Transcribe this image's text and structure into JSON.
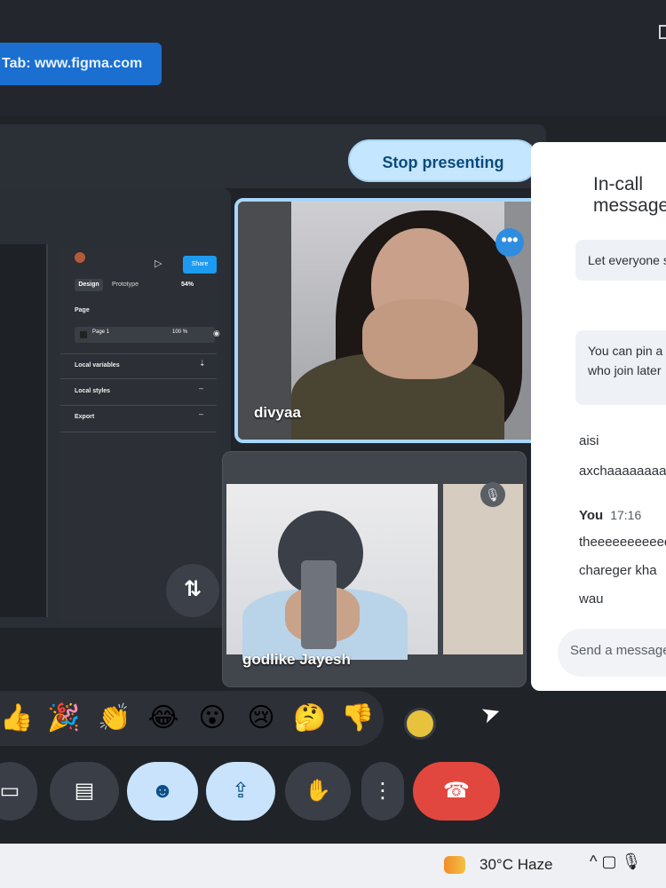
{
  "browser": {
    "tab_banner": "Tab: www.figma.com"
  },
  "meet": {
    "stop_presenting_label": "Stop presenting",
    "swap_icon": "swap-vertical-icon",
    "participants": [
      {
        "name": "divyaa",
        "active_speaker": true
      },
      {
        "name": "godlike Jayesh",
        "muted": true
      }
    ]
  },
  "figma_panel": {
    "share_label": "Share",
    "tab_design": "Design",
    "tab_prototype": "Prototype",
    "zoom": "54%",
    "page_section": "Page",
    "page_name": "Page 1",
    "page_value": "100",
    "page_unit": "%",
    "local_variables": "Local variables",
    "local_styles": "Local styles",
    "export": "Export"
  },
  "chat": {
    "title": "In-call messages",
    "info_1": "Let everyone send messages",
    "info_2_line1": "You can pin a message",
    "info_2_line2": "who join later",
    "messages": [
      {
        "text": "aisi"
      },
      {
        "text": "axchaaaaaaaaa"
      }
    ],
    "you_label": "You",
    "you_time": "17:16",
    "you_messages": [
      "theeeeeeeeeee",
      "chareger kha",
      "wau"
    ],
    "input_placeholder": "Send a message"
  },
  "reactions": [
    "👍",
    "🎉",
    "👏",
    "😂",
    "😮",
    "😢",
    "🤔",
    "👎"
  ],
  "controls": [
    {
      "name": "camera-button",
      "icon": "camera-icon"
    },
    {
      "name": "captions-button",
      "icon": "captions-icon"
    },
    {
      "name": "emoji-button",
      "icon": "emoji-icon",
      "active": true
    },
    {
      "name": "present-button",
      "icon": "present-icon",
      "active": true
    },
    {
      "name": "raise-hand-button",
      "icon": "hand-icon"
    },
    {
      "name": "more-options-button",
      "icon": "more-vert-icon"
    },
    {
      "name": "end-call-button",
      "icon": "phone-end-icon"
    }
  ],
  "taskbar": {
    "weather": "30°C  Haze",
    "weather_temp": "30°C",
    "weather_condition": "Haze"
  },
  "colors": {
    "accent_blue": "#c5e6ff",
    "end_call_red": "#e2473f",
    "tile_highlight": "#a8d6ff"
  }
}
